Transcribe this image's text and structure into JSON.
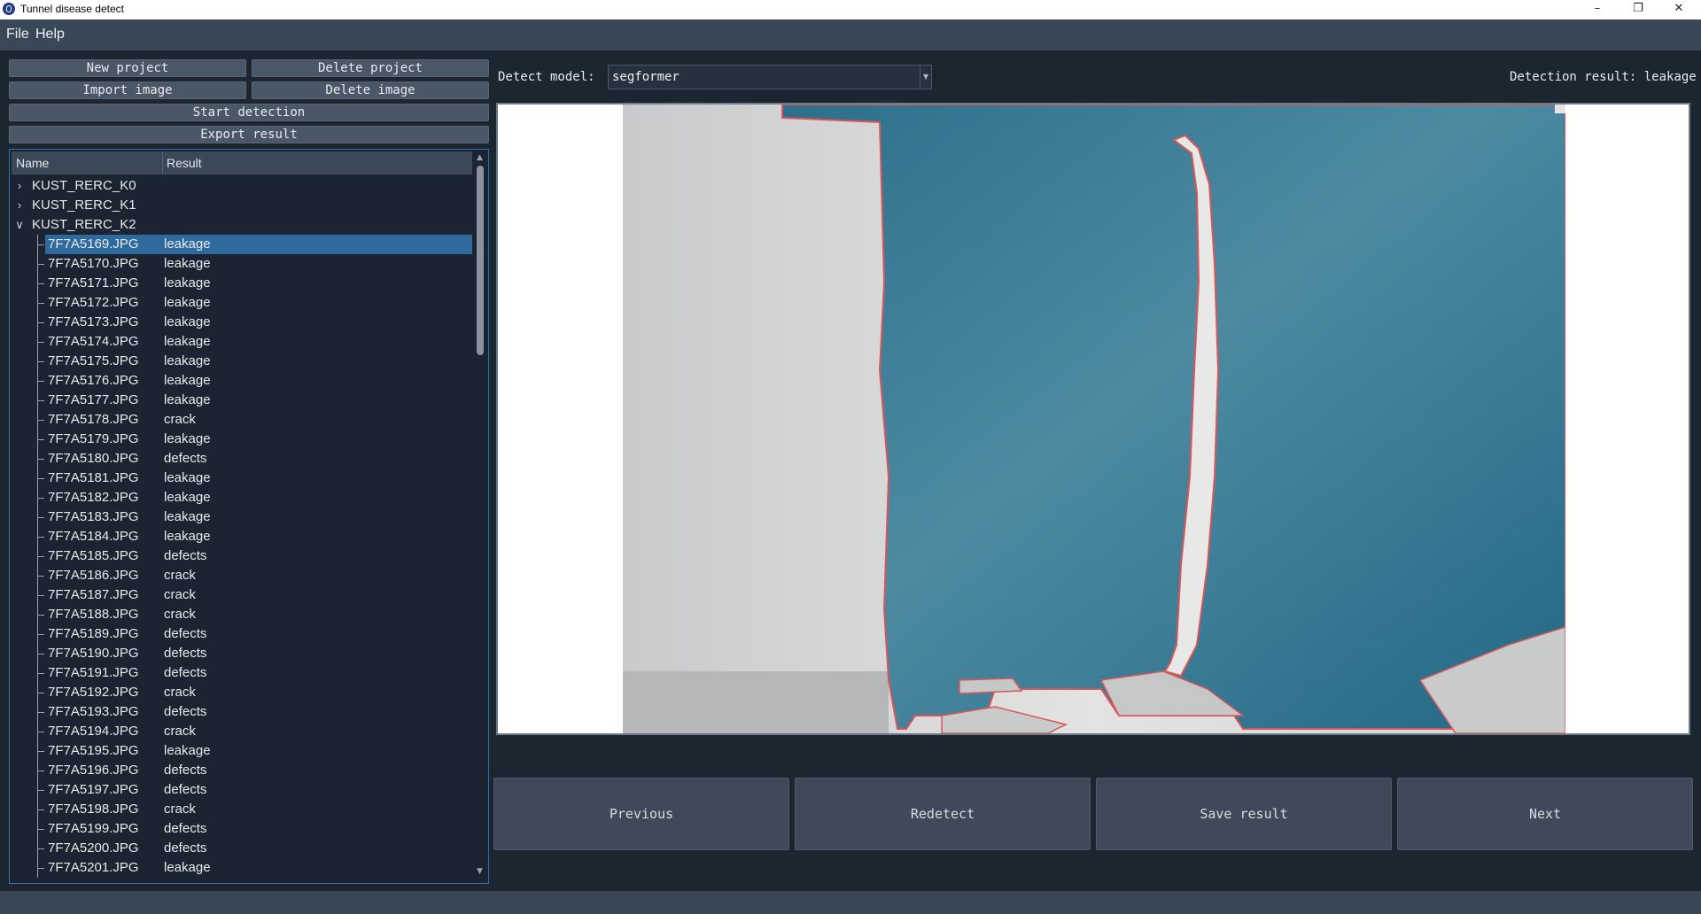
{
  "window": {
    "title": "Tunnel disease detect",
    "minimize_icon": "minimize-icon",
    "restore_icon": "restore-icon",
    "close_icon": "close-icon"
  },
  "menu": {
    "items": [
      "File",
      "Help"
    ]
  },
  "toolbar": {
    "new_project": "New project",
    "delete_project": "Delete project",
    "import_image": "Import image",
    "delete_image": "Delete image",
    "start_detection": "Start detection",
    "export_result": "Export result"
  },
  "tree": {
    "headers": {
      "name": "Name",
      "result": "Result"
    },
    "groups": [
      {
        "name": "KUST_RERC_K0",
        "expanded": false
      },
      {
        "name": "KUST_RERC_K1",
        "expanded": false
      },
      {
        "name": "KUST_RERC_K2",
        "expanded": true
      }
    ],
    "selected_index": 0,
    "items": [
      {
        "name": "7F7A5169.JPG",
        "result": "leakage"
      },
      {
        "name": "7F7A5170.JPG",
        "result": "leakage"
      },
      {
        "name": "7F7A5171.JPG",
        "result": "leakage"
      },
      {
        "name": "7F7A5172.JPG",
        "result": "leakage"
      },
      {
        "name": "7F7A5173.JPG",
        "result": "leakage"
      },
      {
        "name": "7F7A5174.JPG",
        "result": "leakage"
      },
      {
        "name": "7F7A5175.JPG",
        "result": "leakage"
      },
      {
        "name": "7F7A5176.JPG",
        "result": "leakage"
      },
      {
        "name": "7F7A5177.JPG",
        "result": "leakage"
      },
      {
        "name": "7F7A5178.JPG",
        "result": "crack"
      },
      {
        "name": "7F7A5179.JPG",
        "result": "leakage"
      },
      {
        "name": "7F7A5180.JPG",
        "result": "defects"
      },
      {
        "name": "7F7A5181.JPG",
        "result": "leakage"
      },
      {
        "name": "7F7A5182.JPG",
        "result": "leakage"
      },
      {
        "name": "7F7A5183.JPG",
        "result": "leakage"
      },
      {
        "name": "7F7A5184.JPG",
        "result": "leakage"
      },
      {
        "name": "7F7A5185.JPG",
        "result": "defects"
      },
      {
        "name": "7F7A5186.JPG",
        "result": "crack"
      },
      {
        "name": "7F7A5187.JPG",
        "result": "crack"
      },
      {
        "name": "7F7A5188.JPG",
        "result": "crack"
      },
      {
        "name": "7F7A5189.JPG",
        "result": "defects"
      },
      {
        "name": "7F7A5190.JPG",
        "result": "defects"
      },
      {
        "name": "7F7A5191.JPG",
        "result": "defects"
      },
      {
        "name": "7F7A5192.JPG",
        "result": "crack"
      },
      {
        "name": "7F7A5193.JPG",
        "result": "defects"
      },
      {
        "name": "7F7A5194.JPG",
        "result": "crack"
      },
      {
        "name": "7F7A5195.JPG",
        "result": "leakage"
      },
      {
        "name": "7F7A5196.JPG",
        "result": "defects"
      },
      {
        "name": "7F7A5197.JPG",
        "result": "defects"
      },
      {
        "name": "7F7A5198.JPG",
        "result": "crack"
      },
      {
        "name": "7F7A5199.JPG",
        "result": "defects"
      },
      {
        "name": "7F7A5200.JPG",
        "result": "defects"
      },
      {
        "name": "7F7A5201.JPG",
        "result": "leakage"
      }
    ]
  },
  "detect": {
    "model_label": "Detect model:",
    "model_value": "segformer",
    "result_label": "Detection result: leakage"
  },
  "nav": {
    "previous": "Previous",
    "redetect": "Redetect",
    "save_result": "Save result",
    "next": "Next"
  },
  "colors": {
    "background": "#1c2631",
    "panel": "#3a4756",
    "selection": "#2f6a9e",
    "mask": "#2a6f8c",
    "mask_edge": "#e05a5a"
  }
}
